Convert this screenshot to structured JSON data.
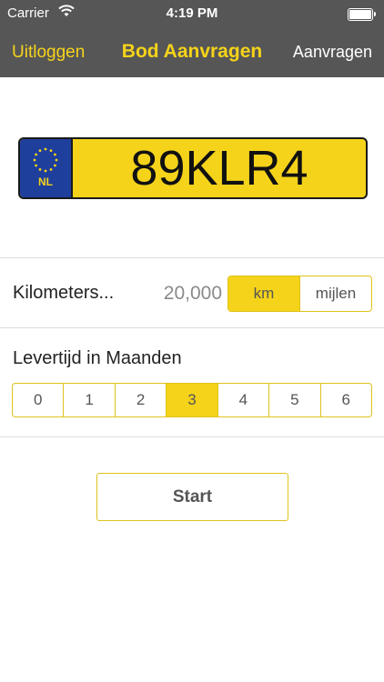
{
  "status_bar": {
    "carrier": "Carrier",
    "time": "4:19 PM",
    "icons": [
      "wifi-icon",
      "battery-icon"
    ]
  },
  "nav": {
    "left_label": "Uitloggen",
    "title": "Bod Aanvragen",
    "right_label": "Aanvragen"
  },
  "plate": {
    "country_code": "NL",
    "number": "89KLR4",
    "icon": "eu-stars-icon"
  },
  "distance": {
    "label": "Kilometers...",
    "value": "20,000",
    "units": [
      {
        "label": "km",
        "selected": true
      },
      {
        "label": "mijlen",
        "selected": false
      }
    ]
  },
  "delivery": {
    "label": "Levertijd in Maanden",
    "options": [
      {
        "label": "0",
        "selected": false
      },
      {
        "label": "1",
        "selected": false
      },
      {
        "label": "2",
        "selected": false
      },
      {
        "label": "3",
        "selected": true
      },
      {
        "label": "4",
        "selected": false
      },
      {
        "label": "5",
        "selected": false
      },
      {
        "label": "6",
        "selected": false
      }
    ]
  },
  "start_button": "Start",
  "colors": {
    "accent": "#f5d31a",
    "bar": "#565656",
    "eu_blue": "#1e3f9c"
  }
}
